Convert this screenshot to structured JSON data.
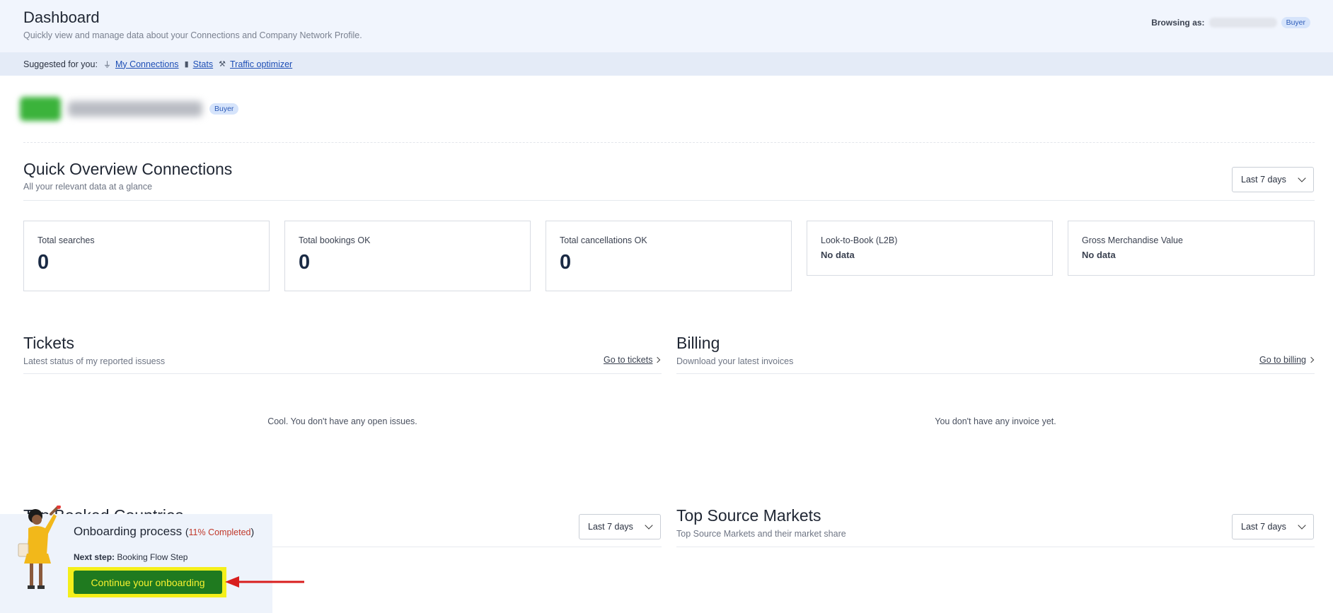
{
  "header": {
    "title": "Dashboard",
    "subtitle": "Quickly view and manage data about your Connections and Company Network Profile.",
    "browsing_label": "Browsing as:",
    "role_badge": "Buyer"
  },
  "suggested": {
    "label": "Suggested for you:",
    "links": [
      {
        "label": "My Connections",
        "icon": "plug-icon"
      },
      {
        "label": "Stats",
        "icon": "bar-chart-icon"
      },
      {
        "label": "Traffic optimizer",
        "icon": "wrench-icon"
      }
    ]
  },
  "company": {
    "badge": "Buyer"
  },
  "overview": {
    "title": "Quick Overview Connections",
    "subtitle": "All your relevant data at a glance",
    "range": "Last 7 days",
    "cards": [
      {
        "label": "Total searches",
        "value": "0"
      },
      {
        "label": "Total bookings OK",
        "value": "0"
      },
      {
        "label": "Total cancellations OK",
        "value": "0"
      },
      {
        "label": "Look-to-Book (L2B)",
        "value": "No data"
      },
      {
        "label": "Gross Merchandise Value",
        "value": "No data"
      }
    ]
  },
  "tickets": {
    "title": "Tickets",
    "subtitle": "Latest status of my reported issuess",
    "link": "Go to tickets",
    "empty": "Cool. You don't have any open issues."
  },
  "billing": {
    "title": "Billing",
    "subtitle": "Download your latest invoices",
    "link": "Go to billing",
    "empty": "You don't have any invoice yet."
  },
  "booked_countries": {
    "title": "Top Booked Countries",
    "range": "Last 7 days"
  },
  "source_markets": {
    "title": "Top Source Markets",
    "subtitle": "Top Source Markets and their market share",
    "range": "Last 7 days"
  },
  "onboarding": {
    "title": "Onboarding process",
    "progress": "11% Completed",
    "next_label": "Next step:",
    "next_value": "Booking Flow Step",
    "button": "Continue your onboarding"
  },
  "colors": {
    "header_bg": "#f1f5fd",
    "suggest_bg": "#e4ebf7",
    "link": "#1d4eb5",
    "onboard_button": "#1f7a1f",
    "highlight": "#f4ef1a",
    "arrow": "#d81e1e"
  }
}
